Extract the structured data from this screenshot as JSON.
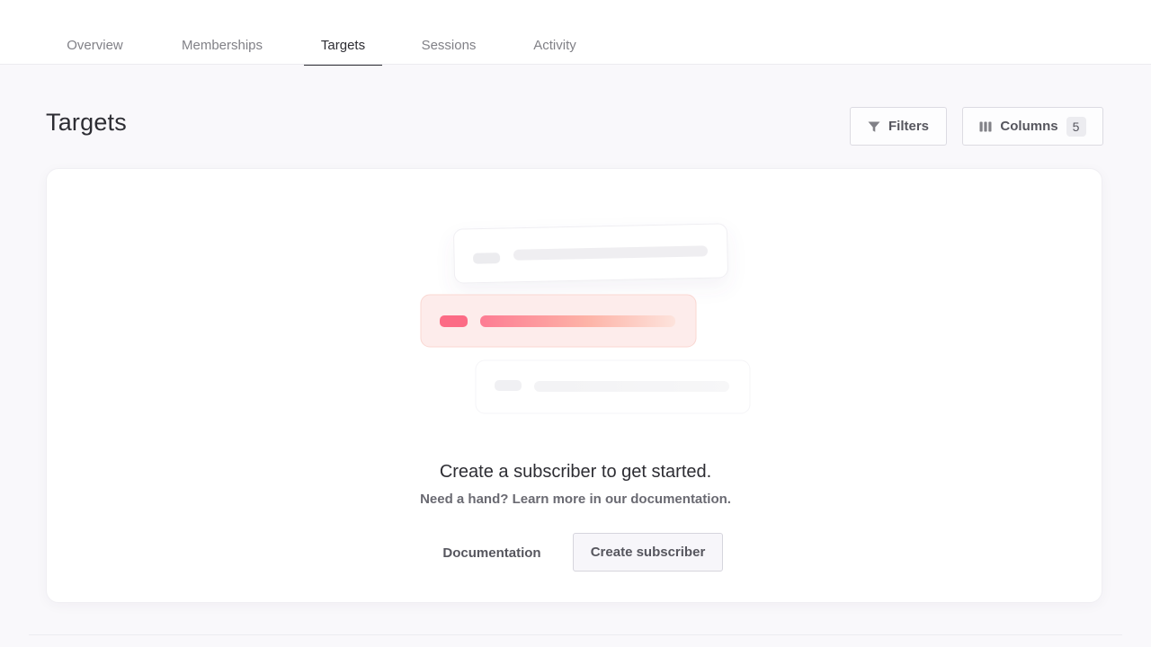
{
  "tabs": [
    {
      "label": "Overview"
    },
    {
      "label": "Memberships"
    },
    {
      "label": "Targets",
      "active": true
    },
    {
      "label": "Sessions"
    },
    {
      "label": "Activity"
    }
  ],
  "header": {
    "title": "Targets",
    "filters_label": "Filters",
    "filters_icon": "funnel-icon",
    "columns_label": "Columns",
    "columns_icon": "columns-icon",
    "columns_count": "5"
  },
  "empty_state": {
    "title": "Create a subscriber to get started.",
    "subtitle": "Need a hand? Learn more in our documentation.",
    "documentation_label": "Documentation",
    "create_label": "Create subscriber"
  },
  "colors": {
    "accent": "#fd366e",
    "text": "#2d2d33",
    "muted": "#818187",
    "background": "#f9f8fb"
  }
}
